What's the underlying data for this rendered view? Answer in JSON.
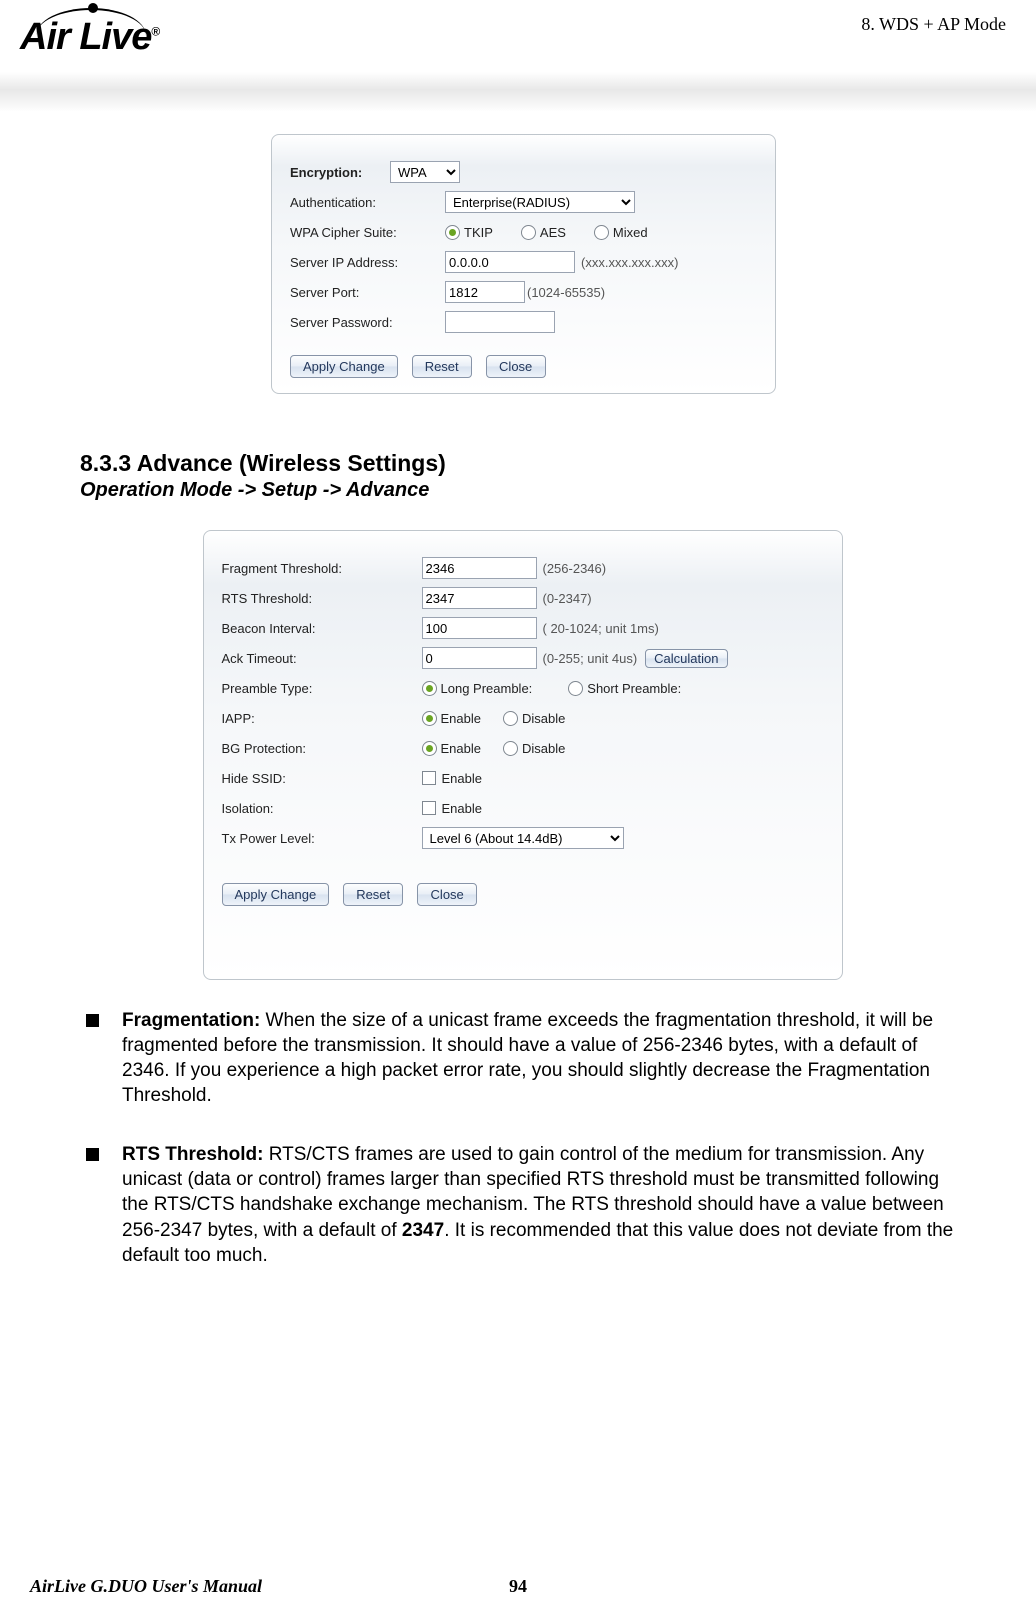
{
  "chapter": "8.  WDS  +  AP  Mode",
  "logo_text": "Air Live",
  "panel1": {
    "encryption_label": "Encryption:",
    "encryption_value": "WPA",
    "auth_label": "Authentication:",
    "auth_value": "Enterprise(RADIUS)",
    "cipher_label": "WPA Cipher Suite:",
    "cipher_tkip": "TKIP",
    "cipher_aes": "AES",
    "cipher_mixed": "Mixed",
    "server_ip_label": "Server IP Address:",
    "server_ip_value": "0.0.0.0",
    "server_ip_hint": "(xxx.xxx.xxx.xxx)",
    "server_port_label": "Server Port:",
    "server_port_value": "1812",
    "server_port_hint": "(1024-65535)",
    "server_pw_label": "Server Password:",
    "apply": "Apply Change",
    "reset": "Reset",
    "close": "Close"
  },
  "section": {
    "title": "8.3.3 Advance (Wireless Settings)",
    "path": "Operation Mode -> Setup -> Advance"
  },
  "panel2": {
    "frag_label": "Fragment Threshold:",
    "frag_value": "2346",
    "frag_hint": "(256-2346)",
    "rts_label": "RTS Threshold:",
    "rts_value": "2347",
    "rts_hint": "(0-2347)",
    "beacon_label": "Beacon Interval:",
    "beacon_value": "100",
    "beacon_hint": "( 20-1024; unit 1ms)",
    "ack_label": "Ack Timeout:",
    "ack_value": "0",
    "ack_hint": "(0-255; unit 4us)",
    "calc": "Calculation",
    "preamble_label": "Preamble Type:",
    "preamble_long": "Long Preamble:",
    "preamble_short": "Short Preamble:",
    "iapp_label": "IAPP:",
    "enable": "Enable",
    "disable": "Disable",
    "bgprot_label": "BG Protection:",
    "hide_label": "Hide SSID:",
    "iso_label": "Isolation:",
    "txpwr_label": "Tx Power Level:",
    "txpwr_value": "Level 6 (About 14.4dB)",
    "apply": "Apply Change",
    "reset": "Reset",
    "close": "Close"
  },
  "bullets": {
    "frag_title": "Fragmentation:",
    "frag_text": " When the size of a unicast frame exceeds the fragmentation threshold, it will be fragmented before the transmission. It should have a value of 256-2346 bytes, with a default of 2346.    If you experience a high packet error rate, you should slightly decrease the Fragmentation Threshold.",
    "rts_title": "RTS Threshold:",
    "rts_text_a": " RTS/CTS frames are used to gain control of the medium for transmission. Any unicast (data or control) frames larger than specified RTS threshold must be transmitted following the RTS/CTS handshake exchange mechanism. The RTS threshold should have a value between 256-2347 bytes, with a default of ",
    "rts_bold": "2347",
    "rts_text_b": ". It is recommended that this value does not deviate from the default too much."
  },
  "footer": {
    "manual": "AirLive G.DUO User's Manual",
    "page": "94"
  }
}
